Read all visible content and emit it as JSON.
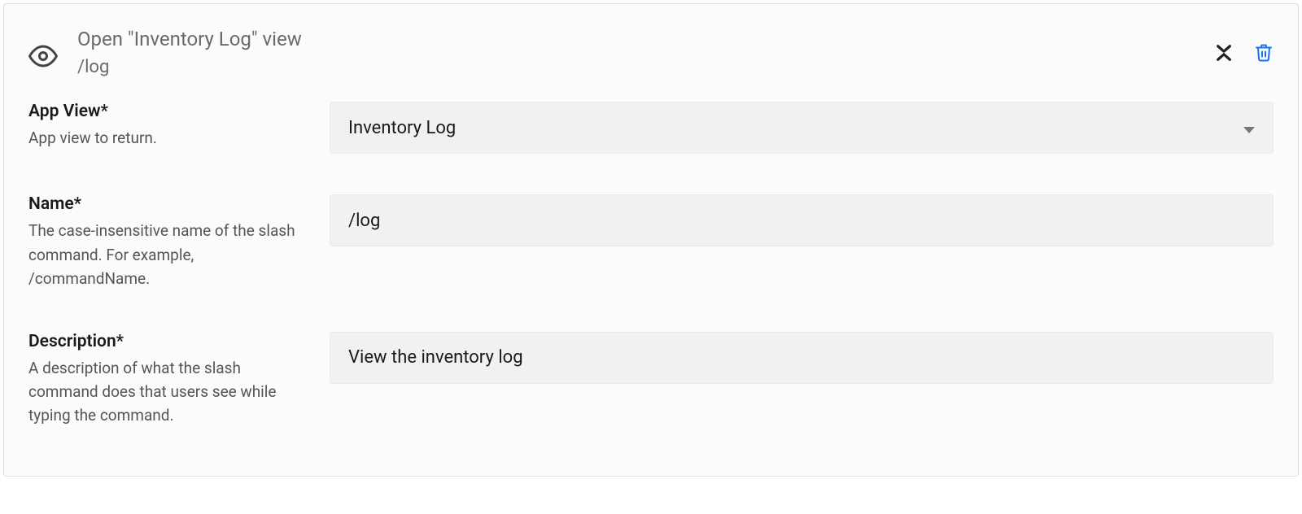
{
  "header": {
    "title": "Open \"Inventory Log\" view",
    "subtitle": "/log"
  },
  "fields": {
    "app_view": {
      "label": "App View*",
      "help": "App view to return.",
      "value": "Inventory Log"
    },
    "name": {
      "label": "Name*",
      "help": "The case-insensitive name of the slash command. For example, /commandName.",
      "value": "/log"
    },
    "description": {
      "label": "Description*",
      "help": "A description of what the slash command does that users see while typing the command.",
      "value": "View the inventory log"
    }
  }
}
